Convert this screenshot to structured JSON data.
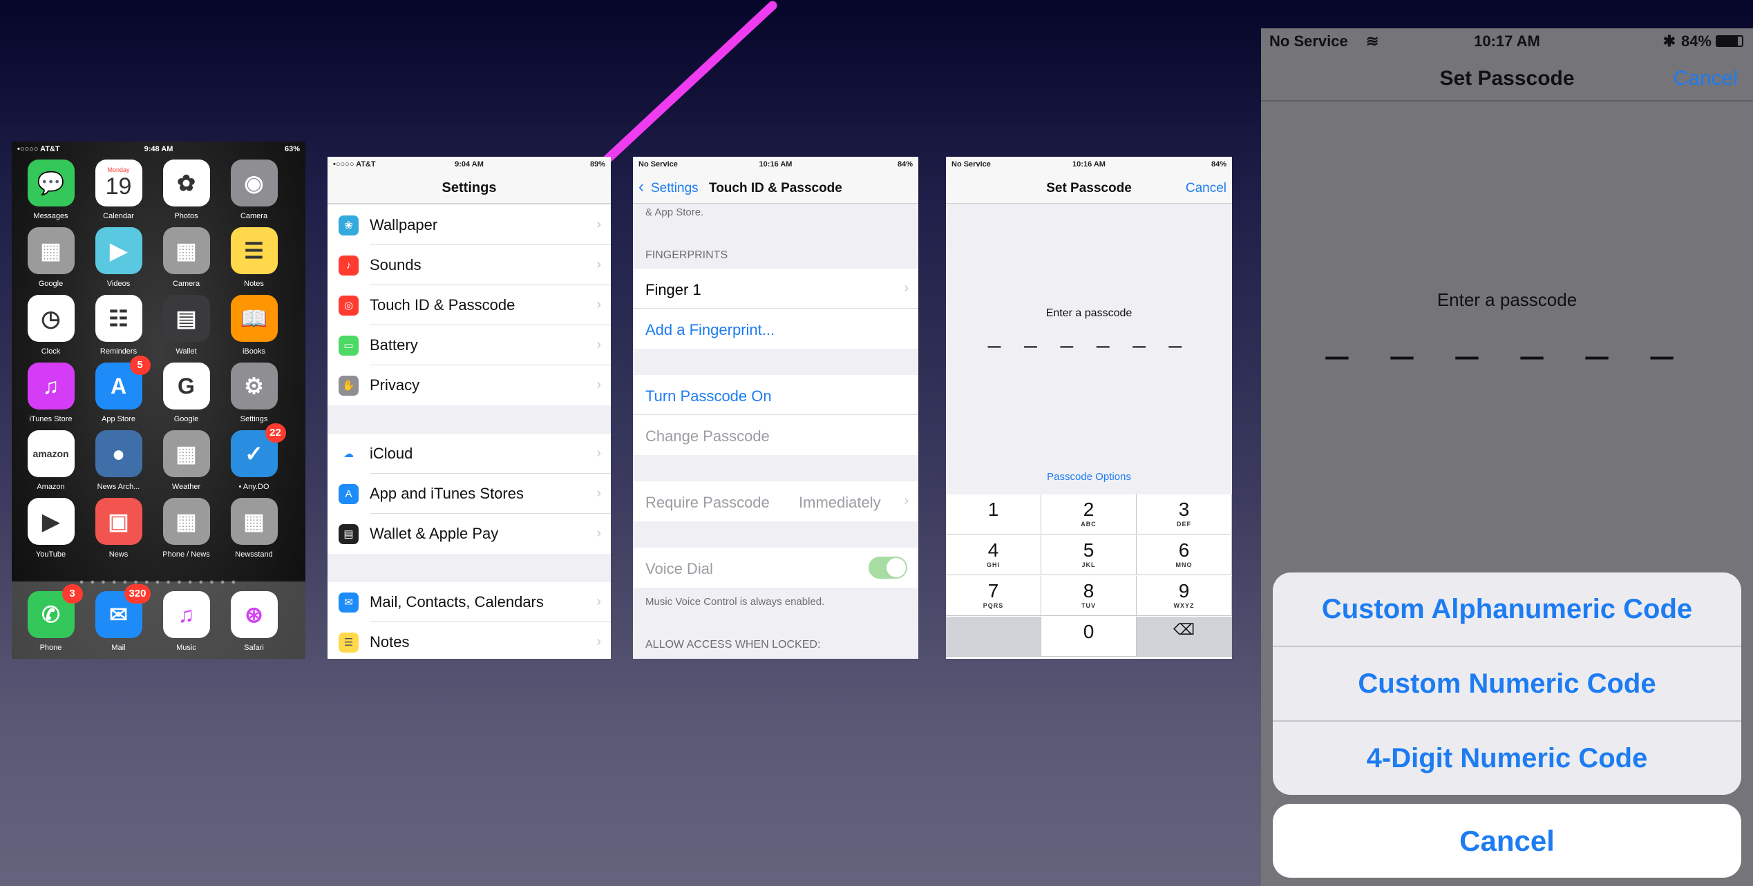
{
  "home": {
    "status": {
      "carrier": "•○○○○ AT&T",
      "time": "9:48 AM",
      "battery": "63%"
    },
    "apps": [
      {
        "label": "Messages",
        "icon": "messages-icon",
        "color": "#34c759",
        "glyph": "💬"
      },
      {
        "label": "Calendar",
        "icon": "calendar-icon",
        "color": "#ffffff",
        "glyph": "19",
        "sub": "Monday"
      },
      {
        "label": "Photos",
        "icon": "photos-icon",
        "color": "#ffffff",
        "glyph": "✿"
      },
      {
        "label": "Camera",
        "icon": "camera-icon",
        "color": "#8e8e93",
        "glyph": "◉"
      },
      {
        "label": "Google",
        "icon": "google-folder-icon",
        "color": "#9b9b9b",
        "glyph": "▦"
      },
      {
        "label": "Videos",
        "icon": "videos-icon",
        "color": "#5ac8e0",
        "glyph": "▶"
      },
      {
        "label": "Camera",
        "icon": "camera-folder-icon",
        "color": "#9b9b9b",
        "glyph": "▦"
      },
      {
        "label": "Notes",
        "icon": "notes-icon",
        "color": "#ffd84c",
        "glyph": "☰"
      },
      {
        "label": "Clock",
        "icon": "clock-icon",
        "color": "#ffffff",
        "glyph": "◷"
      },
      {
        "label": "Reminders",
        "icon": "reminders-icon",
        "color": "#ffffff",
        "glyph": "☷"
      },
      {
        "label": "Wallet",
        "icon": "wallet-icon",
        "color": "#3a3a3c",
        "glyph": "▤"
      },
      {
        "label": "iBooks",
        "icon": "ibooks-icon",
        "color": "#ff9500",
        "glyph": "📖"
      },
      {
        "label": "iTunes Store",
        "icon": "itunes-store-icon",
        "color": "#d53cf5",
        "glyph": "♫"
      },
      {
        "label": "App Store",
        "icon": "app-store-icon",
        "color": "#1d8cf8",
        "glyph": "A",
        "badge": "5"
      },
      {
        "label": "Google",
        "icon": "google-icon",
        "color": "#ffffff",
        "glyph": "G"
      },
      {
        "label": "Settings",
        "icon": "settings-icon",
        "color": "#8e8e93",
        "glyph": "⚙"
      },
      {
        "label": "Amazon",
        "icon": "amazon-icon",
        "color": "#ffffff",
        "glyph": "amazon"
      },
      {
        "label": "News Arch...",
        "icon": "news-archive-icon",
        "color": "#3f6fa8",
        "glyph": "●"
      },
      {
        "label": "Weather",
        "icon": "weather-folder-icon",
        "color": "#9b9b9b",
        "glyph": "▦"
      },
      {
        "label": "• Any.DO",
        "icon": "anydo-icon",
        "color": "#2a8ee0",
        "glyph": "✓",
        "badge": "22"
      },
      {
        "label": "YouTube",
        "icon": "youtube-icon",
        "color": "#ffffff",
        "glyph": "▶"
      },
      {
        "label": "News",
        "icon": "news-icon",
        "color": "#f2554f",
        "glyph": "▣"
      },
      {
        "label": "Phone / News",
        "icon": "phone-news-folder-icon",
        "color": "#9b9b9b",
        "glyph": "▦"
      },
      {
        "label": "Newsstand",
        "icon": "newsstand-icon",
        "color": "#9b9b9b",
        "glyph": "▦"
      }
    ],
    "dock": [
      {
        "label": "Phone",
        "icon": "phone-icon",
        "color": "#34c759",
        "glyph": "✆",
        "badge": "3"
      },
      {
        "label": "Mail",
        "icon": "mail-icon",
        "color": "#1d8cf8",
        "glyph": "✉",
        "badge": "320"
      },
      {
        "label": "Music",
        "icon": "music-icon",
        "color": "#ffffff",
        "glyph": "♫"
      },
      {
        "label": "Safari",
        "icon": "safari-icon",
        "color": "#ffffff",
        "glyph": "⊛"
      }
    ]
  },
  "settings": {
    "status": {
      "carrier": "•○○○○ AT&T",
      "time": "9:04 AM",
      "battery": "89%"
    },
    "title": "Settings",
    "rows": [
      {
        "label": "Wallpaper",
        "icon": "wallpaper-icon",
        "color": "#34aadc",
        "glyph": "❀"
      },
      {
        "label": "Sounds",
        "icon": "sounds-icon",
        "color": "#ff3b30",
        "glyph": "♪"
      },
      {
        "label": "Touch ID & Passcode",
        "icon": "touch-id-icon",
        "color": "#ff3b30",
        "glyph": "◎"
      },
      {
        "label": "Battery",
        "icon": "battery-icon",
        "color": "#4cd964",
        "glyph": "▭"
      },
      {
        "label": "Privacy",
        "icon": "privacy-icon",
        "color": "#8e8e93",
        "glyph": "✋"
      },
      {
        "label": "iCloud",
        "icon": "icloud-icon",
        "color": "#ffffff",
        "glyph": "☁"
      },
      {
        "label": "App and iTunes Stores",
        "icon": "app-itunes-stores-icon",
        "color": "#1d8cf8",
        "glyph": "A"
      },
      {
        "label": "Wallet & Apple Pay",
        "icon": "wallet-apple-pay-icon",
        "color": "#222222",
        "glyph": "▤"
      },
      {
        "label": "Mail, Contacts, Calendars",
        "icon": "mail-contacts-icon",
        "color": "#1d8cf8",
        "glyph": "✉"
      },
      {
        "label": "Notes",
        "icon": "notes-icon",
        "color": "#ffd84c",
        "glyph": "☰"
      }
    ]
  },
  "touchid": {
    "status": {
      "carrier": "No Service",
      "time": "10:16 AM",
      "battery": "84%"
    },
    "back_label": "Settings",
    "title": "Touch ID & Passcode",
    "top_text": "& App Store.",
    "fingerprints_header": "FINGERPRINTS",
    "finger1": "Finger 1",
    "add_fingerprint": "Add a Fingerprint...",
    "turn_passcode_on": "Turn Passcode On",
    "change_passcode": "Change Passcode",
    "require_passcode": "Require Passcode",
    "require_value": "Immediately",
    "voice_dial": "Voice Dial",
    "voice_dial_on": true,
    "voice_note": "Music Voice Control is always enabled.",
    "allow_access_header": "ALLOW ACCESS WHEN LOCKED:"
  },
  "setpass_small": {
    "status": {
      "carrier": "No Service",
      "time": "10:16 AM",
      "battery": "84%"
    },
    "title": "Set Passcode",
    "cancel": "Cancel",
    "prompt": "Enter a passcode",
    "options_link": "Passcode Options",
    "keys": [
      {
        "num": "1",
        "letters": ""
      },
      {
        "num": "2",
        "letters": "ABC"
      },
      {
        "num": "3",
        "letters": "DEF"
      },
      {
        "num": "4",
        "letters": "GHI"
      },
      {
        "num": "5",
        "letters": "JKL"
      },
      {
        "num": "6",
        "letters": "MNO"
      },
      {
        "num": "7",
        "letters": "PQRS"
      },
      {
        "num": "8",
        "letters": "TUV"
      },
      {
        "num": "9",
        "letters": "WXYZ"
      },
      {
        "num": "",
        "letters": ""
      },
      {
        "num": "0",
        "letters": ""
      },
      {
        "num": "⌫",
        "letters": ""
      }
    ]
  },
  "setpass_large": {
    "status": {
      "carrier": "No Service",
      "time": "10:17 AM",
      "battery": "84%"
    },
    "title": "Set Passcode",
    "cancel": "Cancel",
    "prompt": "Enter a passcode",
    "options": [
      "Custom Alphanumeric Code",
      "Custom Numeric Code",
      "4-Digit Numeric Code"
    ],
    "sheet_cancel": "Cancel"
  },
  "colors": {
    "accent": "#1d7cf2",
    "arrow": "#f03cf0",
    "badge": "#ff3b30",
    "toggle_on": "#a7dca2"
  }
}
